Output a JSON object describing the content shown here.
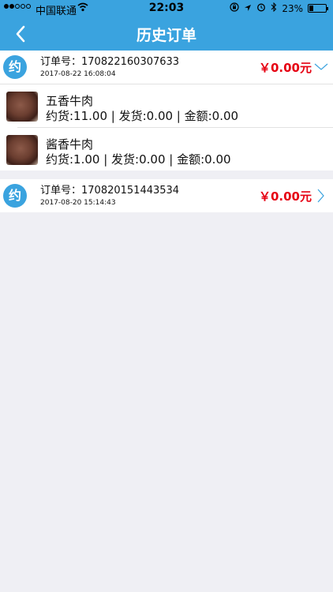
{
  "status_bar": {
    "carrier": "中国联通",
    "time": "22:03",
    "battery": "23%",
    "battery_level": 0.23,
    "icons": [
      "signal-dots-icon",
      "wifi-icon",
      "lock-rotation-icon",
      "location-icon",
      "alarm-icon",
      "bluetooth-icon",
      "battery-icon"
    ]
  },
  "nav": {
    "title": "历史订单",
    "back_icon": "chevron-left-icon"
  },
  "orders": [
    {
      "badge": "约",
      "order_no": "订单号：170822160307633",
      "date": "2017-08-22 16:08:04",
      "amount": "￥0.00元",
      "expanded": true,
      "items": [
        {
          "name": "五香牛肉",
          "detail": "约货:11.00 | 发货:0.00 | 金额:0.00"
        },
        {
          "name": "酱香牛肉",
          "detail": "约货:1.00 | 发货:0.00 | 金额:0.00"
        }
      ]
    },
    {
      "badge": "约",
      "order_no": "订单号：170820151443534",
      "date": "2017-08-20 15:14:43",
      "amount": "￥0.00元",
      "expanded": false,
      "items": []
    }
  ],
  "colors": {
    "accent": "#3aa3df",
    "amount": "#e60012",
    "background": "#efeff4"
  }
}
